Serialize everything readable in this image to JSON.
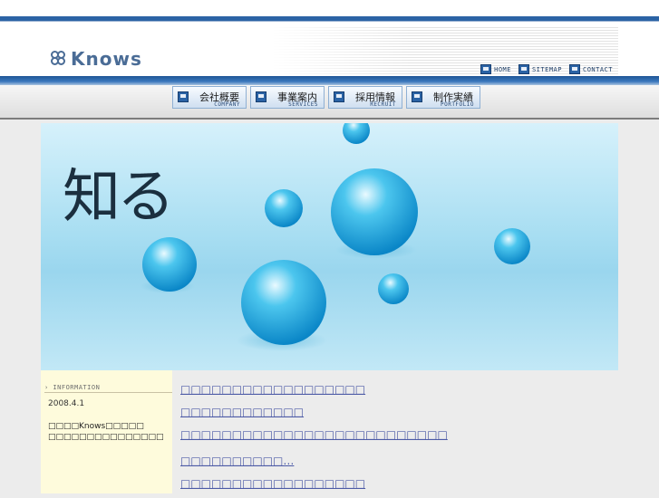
{
  "header": {
    "logo_text": "Knows",
    "top_links": [
      {
        "label": "HOME",
        "icon": "home-icon"
      },
      {
        "label": "SITEMAP",
        "icon": "sitemap-icon"
      },
      {
        "label": "CONTACT",
        "icon": "contact-icon"
      }
    ]
  },
  "nav": {
    "items": [
      {
        "jp": "会社概要",
        "en": "COMPANY",
        "icon": "company-icon"
      },
      {
        "jp": "事業案内",
        "en": "SERVICES",
        "icon": "services-icon"
      },
      {
        "jp": "採用情報",
        "en": "RECRUIT",
        "icon": "recruit-icon"
      },
      {
        "jp": "制作実績",
        "en": "PORTFOLIO",
        "icon": "portfolio-icon"
      }
    ]
  },
  "hero": {
    "title": "知る"
  },
  "info": {
    "heading": "› INFORMATION",
    "date": "2008.4.1",
    "text": "□□□□Knows□□□□□\n□□□□□□□□□□□□□□□"
  },
  "main": {
    "links": [
      "□□□□□□□□□□□□□□□□□□",
      "□□□□□□□□□□□□",
      "□□□□□□□□□□□□□□□□□□□□□□□□□□",
      "□□□□□□□□□□…",
      "□□□□□□□□□□□□□□□□□□"
    ]
  },
  "colors": {
    "accent": "#2b63a5",
    "link": "#4c5aa6",
    "info_bg": "#fefbdc",
    "page_bg": "#ececec"
  }
}
